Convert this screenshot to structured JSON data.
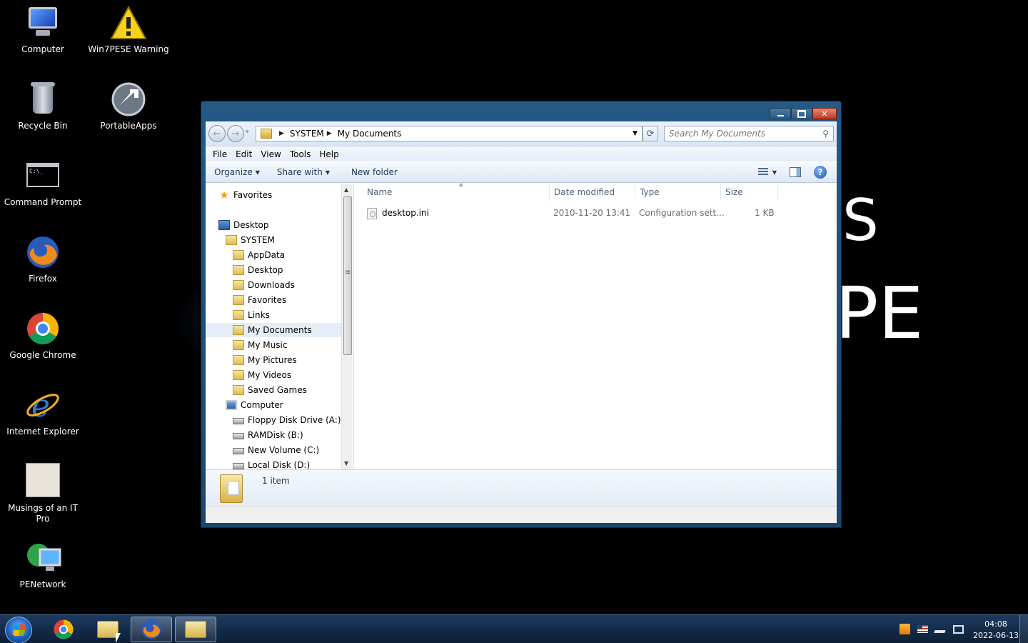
{
  "desktop": {
    "icons": [
      {
        "label": "Computer",
        "icon": "computer-icon"
      },
      {
        "label": "Win7PESE Warning",
        "icon": "warning-icon"
      },
      {
        "label": "Recycle Bin",
        "icon": "recycle-bin-icon"
      },
      {
        "label": "PortableApps",
        "icon": "portableapps-icon"
      },
      {
        "label": "Command Prompt",
        "icon": "command-prompt-icon"
      },
      {
        "label": "Firefox",
        "icon": "firefox-icon"
      },
      {
        "label": "Google Chrome",
        "icon": "chrome-icon"
      },
      {
        "label": "Internet Explorer",
        "icon": "internet-explorer-icon"
      },
      {
        "label": "Musings of an IT Pro",
        "icon": "musings-avatar-icon"
      },
      {
        "label": "PENetwork",
        "icon": "penetwork-icon"
      }
    ],
    "wallpaper_text": {
      "s": "S",
      "pe": "PE"
    }
  },
  "explorer": {
    "breadcrumb": [
      "SYSTEM",
      "My Documents"
    ],
    "search_placeholder": "Search My Documents",
    "menu": [
      "File",
      "Edit",
      "View",
      "Tools",
      "Help"
    ],
    "toolbar": {
      "organize": "Organize",
      "share": "Share with",
      "new_folder": "New folder"
    },
    "nav_tree": [
      {
        "label": "Favorites",
        "icon": "favorites-star-icon",
        "level": 0
      },
      {
        "label": "Desktop",
        "icon": "desktop-icon",
        "level": 0
      },
      {
        "label": "SYSTEM",
        "icon": "user-folder-icon",
        "level": 1
      },
      {
        "label": "AppData",
        "icon": "folder-icon",
        "level": 2
      },
      {
        "label": "Desktop",
        "icon": "folder-icon",
        "level": 2
      },
      {
        "label": "Downloads",
        "icon": "folder-icon",
        "level": 2
      },
      {
        "label": "Favorites",
        "icon": "folder-icon",
        "level": 2
      },
      {
        "label": "Links",
        "icon": "folder-icon",
        "level": 2
      },
      {
        "label": "My Documents",
        "icon": "folder-icon",
        "level": 2,
        "selected": true
      },
      {
        "label": "My Music",
        "icon": "folder-icon",
        "level": 2
      },
      {
        "label": "My Pictures",
        "icon": "folder-icon",
        "level": 2
      },
      {
        "label": "My Videos",
        "icon": "folder-icon",
        "level": 2
      },
      {
        "label": "Saved Games",
        "icon": "folder-icon",
        "level": 2
      },
      {
        "label": "Computer",
        "icon": "computer-icon",
        "level": 1
      },
      {
        "label": "Floppy Disk Drive (A:)",
        "icon": "drive-icon",
        "level": 2
      },
      {
        "label": "RAMDisk (B:)",
        "icon": "drive-icon",
        "level": 2
      },
      {
        "label": "New Volume (C:)",
        "icon": "drive-icon",
        "level": 2
      },
      {
        "label": "Local Disk (D:)",
        "icon": "drive-icon",
        "level": 2
      }
    ],
    "columns": [
      "Name",
      "Date modified",
      "Type",
      "Size"
    ],
    "files": [
      {
        "name": "desktop.ini",
        "date": "2010-11-20 13:41",
        "type": "Configuration sett...",
        "size": "1 KB"
      }
    ],
    "details": {
      "count": "1 item"
    }
  },
  "taskbar": {
    "apps": [
      "chrome",
      "explorer",
      "firefox",
      "explorer"
    ],
    "clock": {
      "time": "04:08",
      "date": "2022-06-13"
    }
  },
  "colors": {
    "window_frame": "#235a86",
    "taskbar": "#1c3a5f",
    "selection": "#e5eef8"
  }
}
